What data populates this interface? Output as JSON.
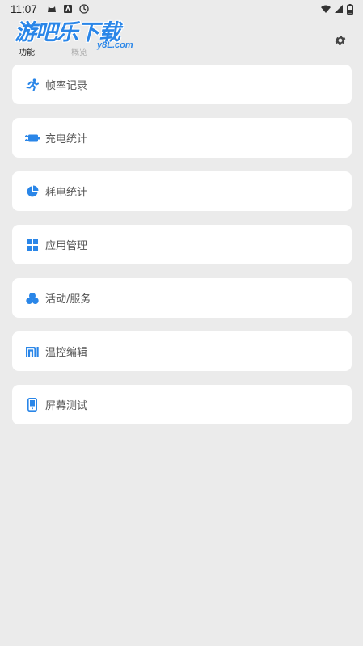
{
  "status_bar": {
    "time": "11:07"
  },
  "watermark": {
    "title": "游吧乐下载",
    "domain": "y8L.com"
  },
  "tabs": [
    {
      "label": "功能"
    },
    {
      "label": "概览"
    }
  ],
  "menu": {
    "items": [
      {
        "label": "帧率记录",
        "icon": "running-icon"
      },
      {
        "label": "充电统计",
        "icon": "charging-icon"
      },
      {
        "label": "耗电统计",
        "icon": "pie-chart-icon"
      },
      {
        "label": "应用管理",
        "icon": "grid-icon"
      },
      {
        "label": "活动/服务",
        "icon": "circles-icon"
      },
      {
        "label": "温控编辑",
        "icon": "mi-icon"
      },
      {
        "label": "屏幕测试",
        "icon": "phone-icon"
      }
    ]
  },
  "colors": {
    "accent": "#2a86e8",
    "background": "#ebebeb",
    "card": "#ffffff"
  }
}
